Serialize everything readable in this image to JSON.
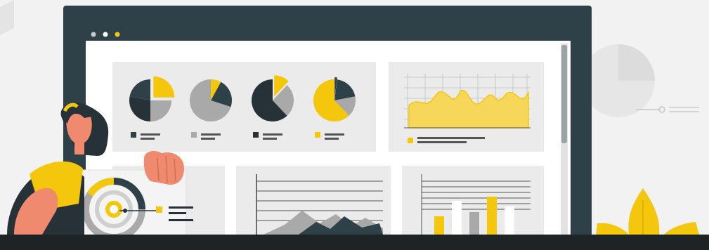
{
  "colors": {
    "background": "#f2f2f2",
    "frame": "#2e4148",
    "screen": "#ffffff",
    "panel": "#ebebeb",
    "yellow": "#f4c60c",
    "gray": "#a9a9a9",
    "dark": "#263238",
    "skin": "#f08a6e",
    "bottom_bar": "#1e2326"
  },
  "window": {
    "dots": [
      "#c9c9c9",
      "#ffffff",
      "#f4c60c"
    ]
  },
  "pie_legend_colors": [
    "#2e4148",
    "#a9a9a9",
    "#263238",
    "#f4c60c"
  ],
  "icons": {
    "window_controls": "traffic-light-dots",
    "pies": "pie-chart-icon",
    "area_chart": "area-chart-icon",
    "bar_chart": "bar-chart-icon",
    "mountain_chart": "mountain-chart-icon",
    "donut": "donut-chart-icon",
    "person": "woman-illustration",
    "plant": "plant-icon"
  }
}
